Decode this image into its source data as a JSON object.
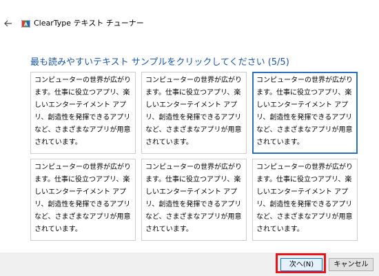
{
  "window": {
    "title": "ClearType テキスト チューナー",
    "back_icon": "arrow-left-icon",
    "app_icon": "cleartype-icon"
  },
  "heading": "最も読みやすいテキスト サンプルをクリックしてください (5/5)",
  "samples": [
    {
      "text": "コンピューターの世界が広がります。仕事に役立つアプリ、楽しいエンターテイメント アプリ、創造性を発揮できるアプリなど、さまざまなアプリが用意されています。",
      "selected": false
    },
    {
      "text": "コンピューターの世界が広がります。仕事に役立つアプリ、楽しいエンターテイメント アプリ、創造性を発揮できるアプリなど、さまざまなアプリが用意されています。",
      "selected": false
    },
    {
      "text": "コンピューターの世界が広がります。仕事に役立つアプリ、楽しいエンターテイメント アプリ、創造性を発揮できるアプリなど、さまざまなアプリが用意されています。",
      "selected": true
    },
    {
      "text": "コンピューターの世界が広がります。仕事に役立つアプリ、楽しいエンターテイメント アプリ、創造性を発揮できるアプリなど、さまざまなアプリが用意されています。",
      "selected": false
    },
    {
      "text": "コンピューターの世界が広がります。仕事に役立つアプリ、楽しいエンターテイメント アプリ、創造性を発揮できるアプリなど、さまざまなアプリが用意されています。",
      "selected": false
    },
    {
      "text": "コンピューターの世界が広がります。仕事に役立つアプリ、楽しいエンターテイメント アプリ、創造性を発揮できるアプリなど、さまざまなアプリが用意されています。",
      "selected": false
    }
  ],
  "buttons": {
    "next_label": "次へ(N)",
    "cancel_label": "キャンセル"
  },
  "colors": {
    "heading": "#1a57a8",
    "selected_border": "#2a6fbd",
    "highlight": "#e8141b"
  }
}
